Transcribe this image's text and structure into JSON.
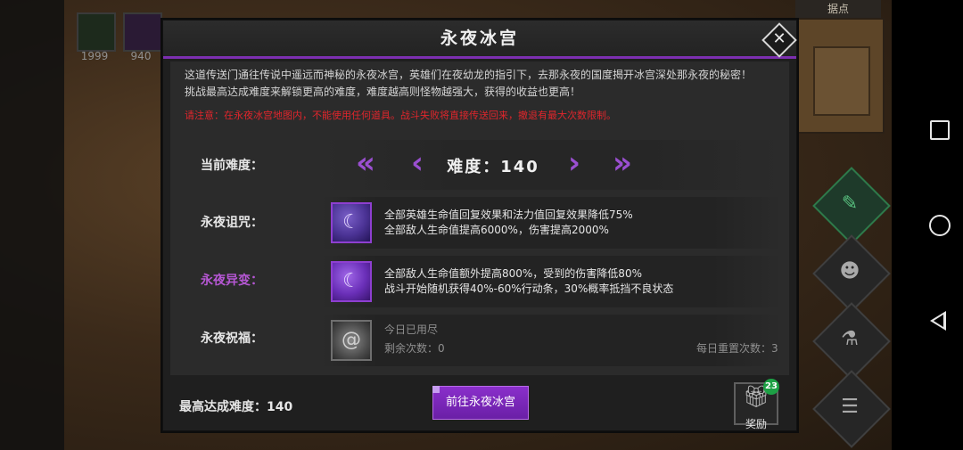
{
  "dialog": {
    "title": "永夜冰宫",
    "description_line1": "这道传送门通往传说中遥远而神秘的永夜冰宫，英雄们在夜幼龙的指引下，去那永夜的国度揭开冰宫深处那永夜的秘密！",
    "description_line2": "挑战最高达成难度来解锁更高的难度，难度越高则怪物越强大，获得的收益也更高！",
    "warning": "请注意：在永夜冰宫地图内，不能使用任何道具。战斗失败将直接传送回来，撤退有最大次数限制。",
    "difficulty": {
      "label": "当前难度：",
      "text": "难度：140",
      "first_glyph": "«",
      "prev_glyph": "‹",
      "next_glyph": "›",
      "last_glyph": "»"
    },
    "curse": {
      "label": "永夜诅咒：",
      "line1": "全部英雄生命值回复效果和法力值回复效果降低75%",
      "line2": "全部敌人生命值提高6000%，伤害提高2000%"
    },
    "mutation": {
      "label": "永夜异变：",
      "line1": "全部敌人生命值额外提高800%，受到的伤害降低80%",
      "line2": "战斗开始随机获得40%-60%行动条，30%概率抵挡不良状态"
    },
    "blessing": {
      "label": "永夜祝福：",
      "status": "今日已用尽",
      "remaining": "剩余次数：0",
      "daily_reset": "每日重置次数：3"
    },
    "footer": {
      "max_difficulty": "最高达成难度：140",
      "go_button": "前往永夜冰宫",
      "reward_label": "奖励",
      "reward_badge": "23"
    },
    "close_glyph": "✕"
  },
  "hud": {
    "resource1_value": "1999",
    "resource2_value": "940",
    "minimap_label": "据点"
  },
  "colors": {
    "accent": "#7c2fb0",
    "warning": "#e0262c",
    "mutation_label": "#b657d4",
    "badge": "#1da145"
  },
  "icons": {
    "curse": "mask-icon",
    "mutation": "mask-icon",
    "blessing": "swirl-icon",
    "reward": "gift-icon"
  }
}
